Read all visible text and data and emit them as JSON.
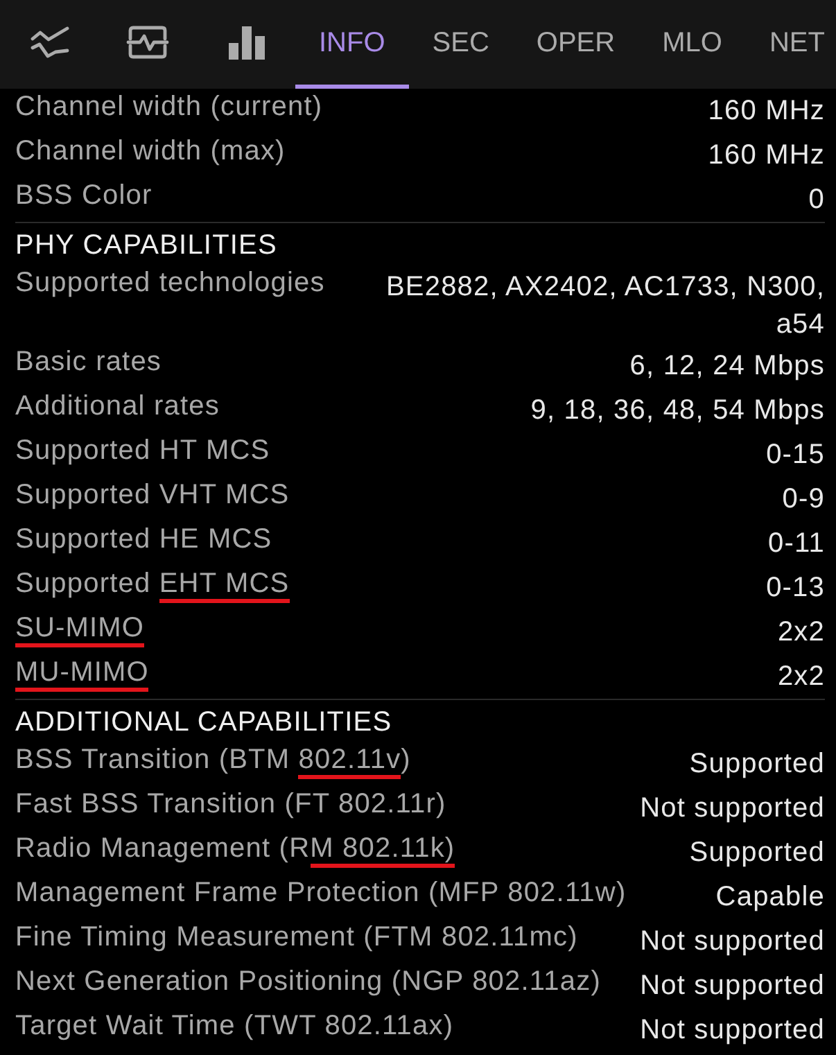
{
  "tabs": [
    {
      "kind": "icon",
      "selected": false
    },
    {
      "kind": "icon",
      "selected": false
    },
    {
      "kind": "icon",
      "selected": false
    },
    {
      "kind": "text",
      "label": "INFO",
      "selected": true
    },
    {
      "kind": "text",
      "label": "SEC",
      "selected": false
    },
    {
      "kind": "text",
      "label": "OPER",
      "selected": false
    },
    {
      "kind": "text",
      "label": "MLO",
      "selected": false
    },
    {
      "kind": "text",
      "label": "NET",
      "selected": false
    }
  ],
  "sections": [
    {
      "rows": [
        {
          "label": [
            {
              "text": "Channel width (current)",
              "underlined": false
            }
          ],
          "value": "160 MHz"
        },
        {
          "label": [
            {
              "text": "Channel width (max)",
              "underlined": false
            }
          ],
          "value": "160 MHz"
        },
        {
          "label": [
            {
              "text": "BSS Color",
              "underlined": false
            }
          ],
          "value": "0"
        }
      ]
    },
    {
      "title": "PHY CAPABILITIES",
      "rows": [
        {
          "label": [
            {
              "text": "Supported technologies",
              "underlined": false
            }
          ],
          "value": "BE2882, AX2402, AC1733, N300, a54"
        },
        {
          "label": [
            {
              "text": "Basic rates",
              "underlined": false
            }
          ],
          "value": "6, 12, 24 Mbps"
        },
        {
          "label": [
            {
              "text": "Additional rates",
              "underlined": false
            }
          ],
          "value": "9, 18, 36, 48, 54 Mbps"
        },
        {
          "label": [
            {
              "text": "Supported HT MCS",
              "underlined": false
            }
          ],
          "value": "0-15"
        },
        {
          "label": [
            {
              "text": "Supported VHT MCS",
              "underlined": false
            }
          ],
          "value": "0-9"
        },
        {
          "label": [
            {
              "text": "Supported HE MCS",
              "underlined": false
            }
          ],
          "value": "0-11"
        },
        {
          "label": [
            {
              "text": "Supported ",
              "underlined": false
            },
            {
              "text": "EHT MCS",
              "underlined": true
            }
          ],
          "value": "0-13"
        },
        {
          "label": [
            {
              "text": "SU-MIMO",
              "underlined": true
            }
          ],
          "value": "2x2"
        },
        {
          "label": [
            {
              "text": "MU-MIMO",
              "underlined": true
            }
          ],
          "value": "2x2"
        }
      ]
    },
    {
      "title": "ADDITIONAL CAPABILITIES",
      "rows": [
        {
          "label": [
            {
              "text": "BSS Transition (BTM ",
              "underlined": false
            },
            {
              "text": "802.11v",
              "underlined": true
            },
            {
              "text": ")",
              "underlined": false
            }
          ],
          "value": "Supported"
        },
        {
          "label": [
            {
              "text": "Fast BSS Transition (FT 802.11r)",
              "underlined": false
            }
          ],
          "value": "Not supported"
        },
        {
          "label": [
            {
              "text": "Radio Management (R",
              "underlined": false
            },
            {
              "text": "M 802.11k)",
              "underlined": true
            }
          ],
          "value": "Supported"
        },
        {
          "label": [
            {
              "text": "Management Frame Protection (MFP 802.11w)",
              "underlined": false
            }
          ],
          "value": "Capable"
        },
        {
          "label": [
            {
              "text": "Fine Timing Measurement (FTM 802.11mc)",
              "underlined": false
            }
          ],
          "value": "Not supported"
        },
        {
          "label": [
            {
              "text": "Next Generation Positioning (NGP 802.11az)",
              "underlined": false
            }
          ],
          "value": "Not supported"
        },
        {
          "label": [
            {
              "text": "Target Wait Time (TWT 802.11ax)",
              "underlined": false
            }
          ],
          "value": "Not supported"
        }
      ]
    }
  ]
}
